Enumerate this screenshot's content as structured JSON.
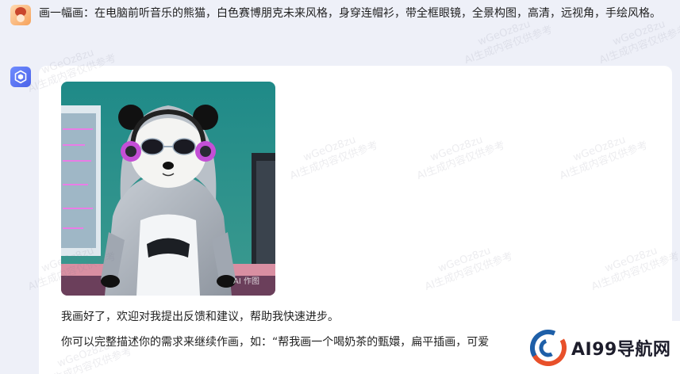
{
  "user_message": {
    "text": "画一幅画：在电脑前听音乐的熊猫，白色赛博朋克未来风格，身穿连帽衫，带全框眼镜，全景构图，高清，远视角，手绘风格。"
  },
  "bot_message": {
    "image_tag": "AI 作图",
    "reply_line1": "我画好了，欢迎对我提出反馈和建议，帮助我快速进步。",
    "reply_line2": "你可以完整描述你的需求来继续作画，如：“帮我画一个喝奶茶的甄嬛，扁平插画，可爱"
  },
  "watermark": {
    "line1": "wGeOz8zu",
    "line2": "AI生成内容仅供参考"
  },
  "brand": {
    "name": "AI99导航网"
  },
  "colors": {
    "background": "#eef0f8",
    "card": "#ffffff",
    "bot_avatar": "#5b74f0",
    "image_bg": "#2a8f8c"
  },
  "icons": {
    "user_avatar": "user-avatar-icon",
    "bot_avatar": "cube-logo-icon",
    "brand_logo": "brand-swirl-icon"
  }
}
